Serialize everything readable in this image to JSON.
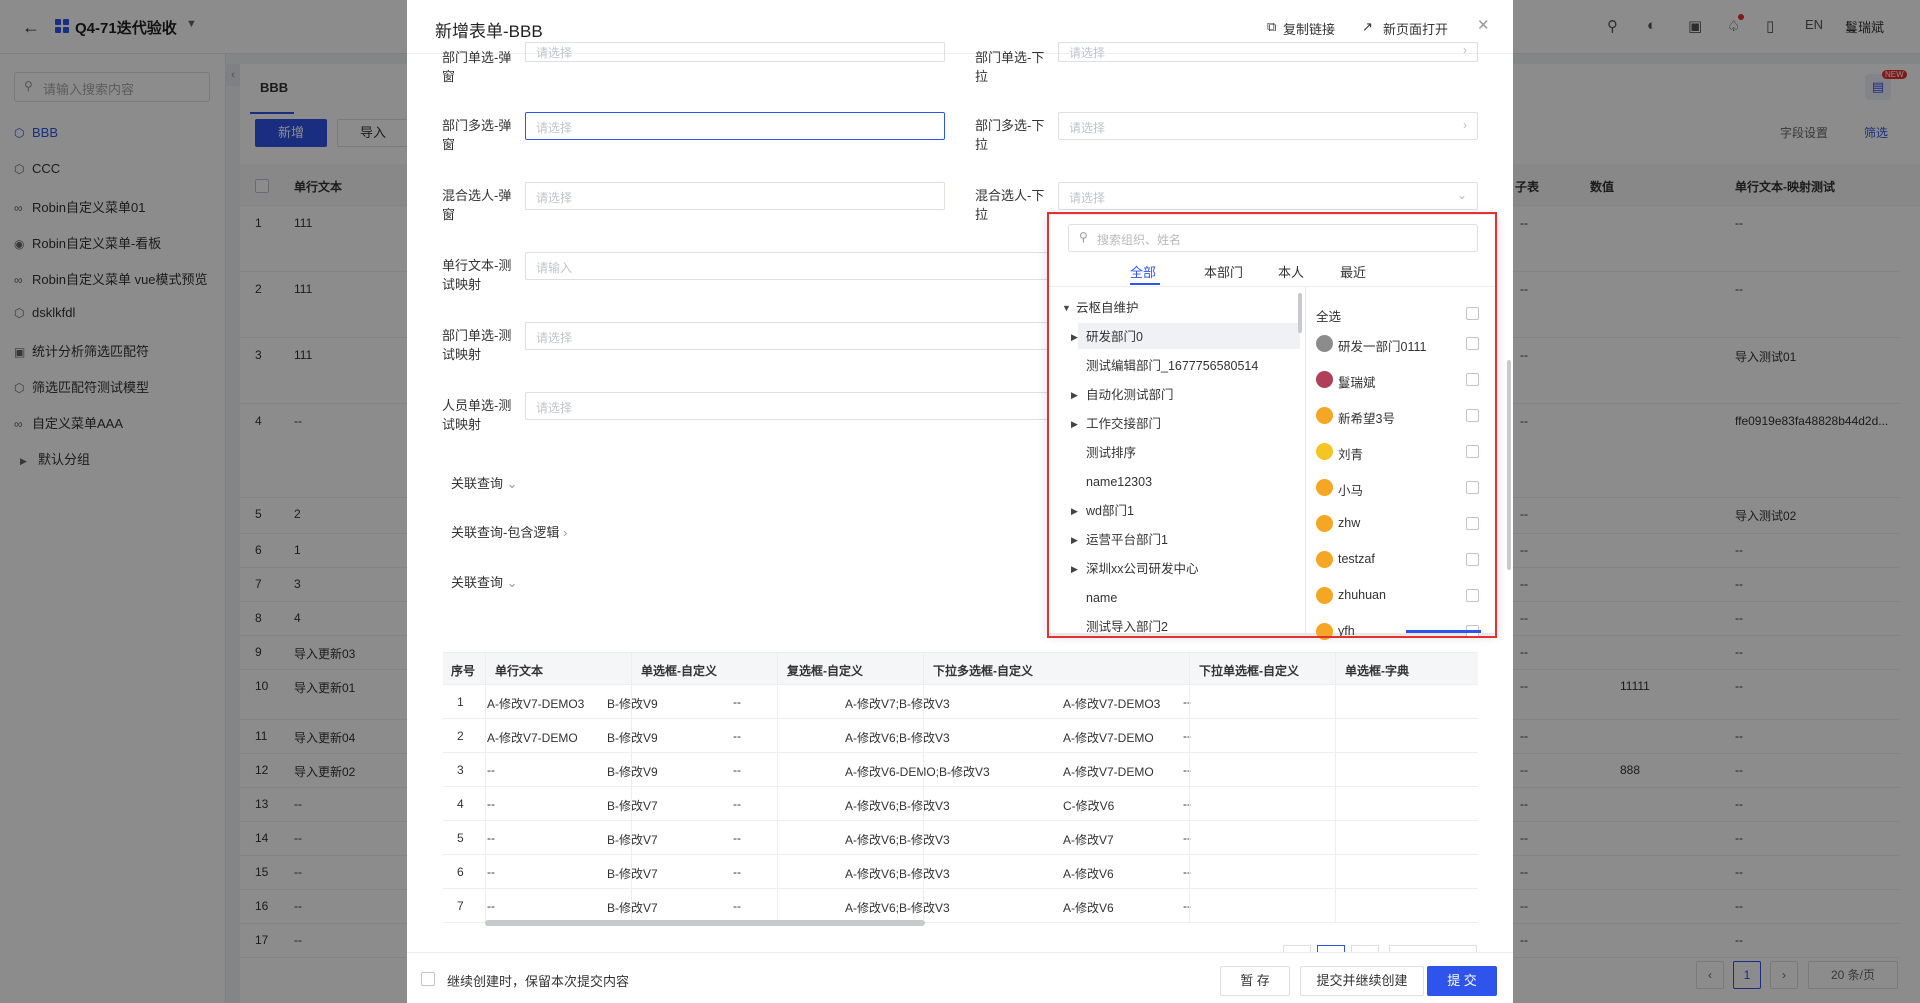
{
  "topbar": {
    "back_icon": "arrow-left-icon",
    "app_title": "Q4-71迭代验收",
    "lang": "EN",
    "user": "鬘瑞斌"
  },
  "sidebar": {
    "search_placeholder": "请输入搜索内容",
    "items": [
      {
        "label": "BBB",
        "icon": "cube-icon",
        "active": true
      },
      {
        "label": "CCC",
        "icon": "cube-icon"
      },
      {
        "label": "Robin自定义菜单01",
        "icon": "link-icon"
      },
      {
        "label": "Robin自定义菜单-看板",
        "icon": "dashboard-icon"
      },
      {
        "label": "Robin自定义菜单 vue模式预览",
        "icon": "link-icon"
      },
      {
        "label": "dsklkfdl",
        "icon": "cube-icon"
      },
      {
        "label": "统计分析筛选匹配符",
        "icon": "monitor-icon"
      },
      {
        "label": "筛选匹配符测试模型",
        "icon": "cube-icon"
      },
      {
        "label": "自定义菜单AAA",
        "icon": "link-icon"
      },
      {
        "label": "默认分组",
        "icon": "caret-right-icon"
      }
    ]
  },
  "main": {
    "tab": "BBB",
    "add_button": "新增",
    "import_button": "导入",
    "field_settings": "字段设置",
    "filter": "筛选",
    "columns": [
      "单行文本",
      "子表",
      "数值",
      "单行文本-映射测试"
    ],
    "rows": [
      {
        "no": "1",
        "text": "111",
        "num": "",
        "map": "--",
        "extra": "--"
      },
      {
        "no": "2",
        "text": "111",
        "num": "",
        "map": "--",
        "extra": "--"
      },
      {
        "no": "3",
        "text": "111",
        "num": "",
        "map": "导入测试01",
        "extra": "--"
      },
      {
        "no": "4",
        "text": "--",
        "num": "",
        "map": "ffe0919e83fa48828b44d2d...",
        "extra": "--"
      },
      {
        "no": "5",
        "text": "2",
        "num": "",
        "map": "导入测试02",
        "extra": "--"
      },
      {
        "no": "6",
        "text": "1",
        "num": "",
        "map": "--",
        "extra": "--"
      },
      {
        "no": "7",
        "text": "3",
        "num": "",
        "map": "--",
        "extra": "--"
      },
      {
        "no": "8",
        "text": "4",
        "num": "",
        "map": "--",
        "extra": "--"
      },
      {
        "no": "9",
        "text": "导入更新03",
        "num": "",
        "map": "--",
        "extra": "--"
      },
      {
        "no": "10",
        "text": "导入更新01",
        "num": "11111",
        "map": "--",
        "extra": "--"
      },
      {
        "no": "11",
        "text": "导入更新04",
        "num": "",
        "map": "--",
        "extra": "--"
      },
      {
        "no": "12",
        "text": "导入更新02",
        "num": "888",
        "map": "--",
        "extra": "--"
      },
      {
        "no": "13",
        "text": "--",
        "num": "",
        "map": "--",
        "extra": "--"
      },
      {
        "no": "14",
        "text": "--",
        "num": "",
        "map": "--",
        "extra": "--"
      },
      {
        "no": "15",
        "text": "--",
        "num": "",
        "map": "--",
        "extra": "--"
      },
      {
        "no": "16",
        "text": "--",
        "num": "",
        "map": "--",
        "extra": "--"
      },
      {
        "no": "17",
        "text": "--",
        "num": "",
        "map": "--",
        "extra": "--"
      }
    ],
    "pager_current": "1",
    "page_size": "20 条/页"
  },
  "modal": {
    "title": "新增表单-BBB",
    "copy_link": "复制链接",
    "open_new": "新页面打开",
    "fields": [
      {
        "label": "部门单选-弹窗",
        "placeholder": "请选择",
        "side": "left"
      },
      {
        "label": "部门单选-下拉",
        "placeholder": "请选择",
        "side": "right"
      },
      {
        "label": "部门多选-弹窗",
        "placeholder": "请选择",
        "side": "left"
      },
      {
        "label": "部门多选-下拉",
        "placeholder": "请选择",
        "side": "right"
      },
      {
        "label": "混合选人-弹窗",
        "placeholder": "请选择",
        "side": "left"
      },
      {
        "label": "混合选人-下拉",
        "placeholder": "请选择",
        "side": "right"
      },
      {
        "label": "单行文本-测试映射",
        "placeholder": "请输入",
        "side": "left"
      },
      {
        "label": "部门单选-测试映射",
        "placeholder": "请选择",
        "side": "left"
      },
      {
        "label": "人员单选-测试映射",
        "placeholder": "请选择",
        "side": "left"
      }
    ],
    "links": [
      "关联查询",
      "关联查询-包含逻辑",
      "关联查询"
    ],
    "subtable": {
      "headers": [
        "序号",
        "单行文本",
        "单选框-自定义",
        "复选框-自定义",
        "下拉多选框-自定义",
        "下拉单选框-自定义",
        "单选框-字典"
      ],
      "rows": [
        [
          "1",
          "A-修改V7-DEMO3",
          "B-修改V9",
          "--",
          "A-修改V7;B-修改V3",
          "A-修改V7-DEMO3",
          "--"
        ],
        [
          "2",
          "A-修改V7-DEMO",
          "B-修改V9",
          "--",
          "A-修改V6;B-修改V3",
          "A-修改V7-DEMO",
          "--"
        ],
        [
          "3",
          "--",
          "B-修改V9",
          "--",
          "A-修改V6-DEMO;B-修改V3",
          "A-修改V7-DEMO",
          "--"
        ],
        [
          "4",
          "--",
          "B-修改V7",
          "--",
          "A-修改V6;B-修改V3",
          "C-修改V6",
          "--"
        ],
        [
          "5",
          "--",
          "B-修改V7",
          "--",
          "A-修改V6;B-修改V3",
          "A-修改V7",
          "--"
        ],
        [
          "6",
          "--",
          "B-修改V7",
          "--",
          "A-修改V6;B-修改V3",
          "A-修改V6",
          "--"
        ],
        [
          "7",
          "--",
          "B-修改V7",
          "--",
          "A-修改V6;B-修改V3",
          "A-修改V6",
          "--"
        ]
      ]
    },
    "footer": {
      "keep_label": "继续创建时，保留本次提交内容",
      "save_draft": "暂 存",
      "submit_continue": "提交并继续创建",
      "submit": "提 交"
    }
  },
  "picker": {
    "search_placeholder": "搜索组织、姓名",
    "tabs": [
      "全部",
      "本部门",
      "本人",
      "最近"
    ],
    "tree": [
      {
        "label": "云枢自维护",
        "level": 0,
        "caret": "down"
      },
      {
        "label": "研发部门0",
        "level": 1,
        "caret": "right",
        "selected": true
      },
      {
        "label": "测试编辑部门_1677756580514",
        "level": 1,
        "caret": ""
      },
      {
        "label": "自动化测试部门",
        "level": 1,
        "caret": "right"
      },
      {
        "label": "工作交接部门",
        "level": 1,
        "caret": "right"
      },
      {
        "label": "测试排序",
        "level": 1,
        "caret": ""
      },
      {
        "label": "name12303",
        "level": 1,
        "caret": ""
      },
      {
        "label": "wd部门1",
        "level": 1,
        "caret": "right"
      },
      {
        "label": "运营平台部门1",
        "level": 1,
        "caret": "right"
      },
      {
        "label": "深圳xx公司研发中心",
        "level": 1,
        "caret": "right"
      },
      {
        "label": "name",
        "level": 1,
        "caret": ""
      },
      {
        "label": "测试导入部门2",
        "level": 1,
        "caret": ""
      }
    ],
    "select_all": "全选",
    "users": [
      {
        "name": "研发一部门0111",
        "avatar": "dept-avatar-icon",
        "color": "#8c8c8c"
      },
      {
        "name": "鬘瑞斌",
        "avatar": "photo-avatar-icon",
        "color": "#b0405a"
      },
      {
        "name": "新希望3号",
        "avatar": "user-avatar-icon",
        "color": "#f5a623"
      },
      {
        "name": "刘青",
        "avatar": "trophy-avatar-icon",
        "color": "#f5c623"
      },
      {
        "name": "小马",
        "avatar": "user-avatar-icon",
        "color": "#f5a623"
      },
      {
        "name": "zhw",
        "avatar": "user-avatar-icon",
        "color": "#f5a623"
      },
      {
        "name": "testzaf",
        "avatar": "user-avatar-icon",
        "color": "#f5a623"
      },
      {
        "name": "zhuhuan",
        "avatar": "user-avatar-icon",
        "color": "#f5a623"
      },
      {
        "name": "yfh",
        "avatar": "user-avatar-icon",
        "color": "#f5a623"
      }
    ]
  },
  "colors": {
    "primary": "#2f54eb",
    "highlight": "#e8312f"
  }
}
